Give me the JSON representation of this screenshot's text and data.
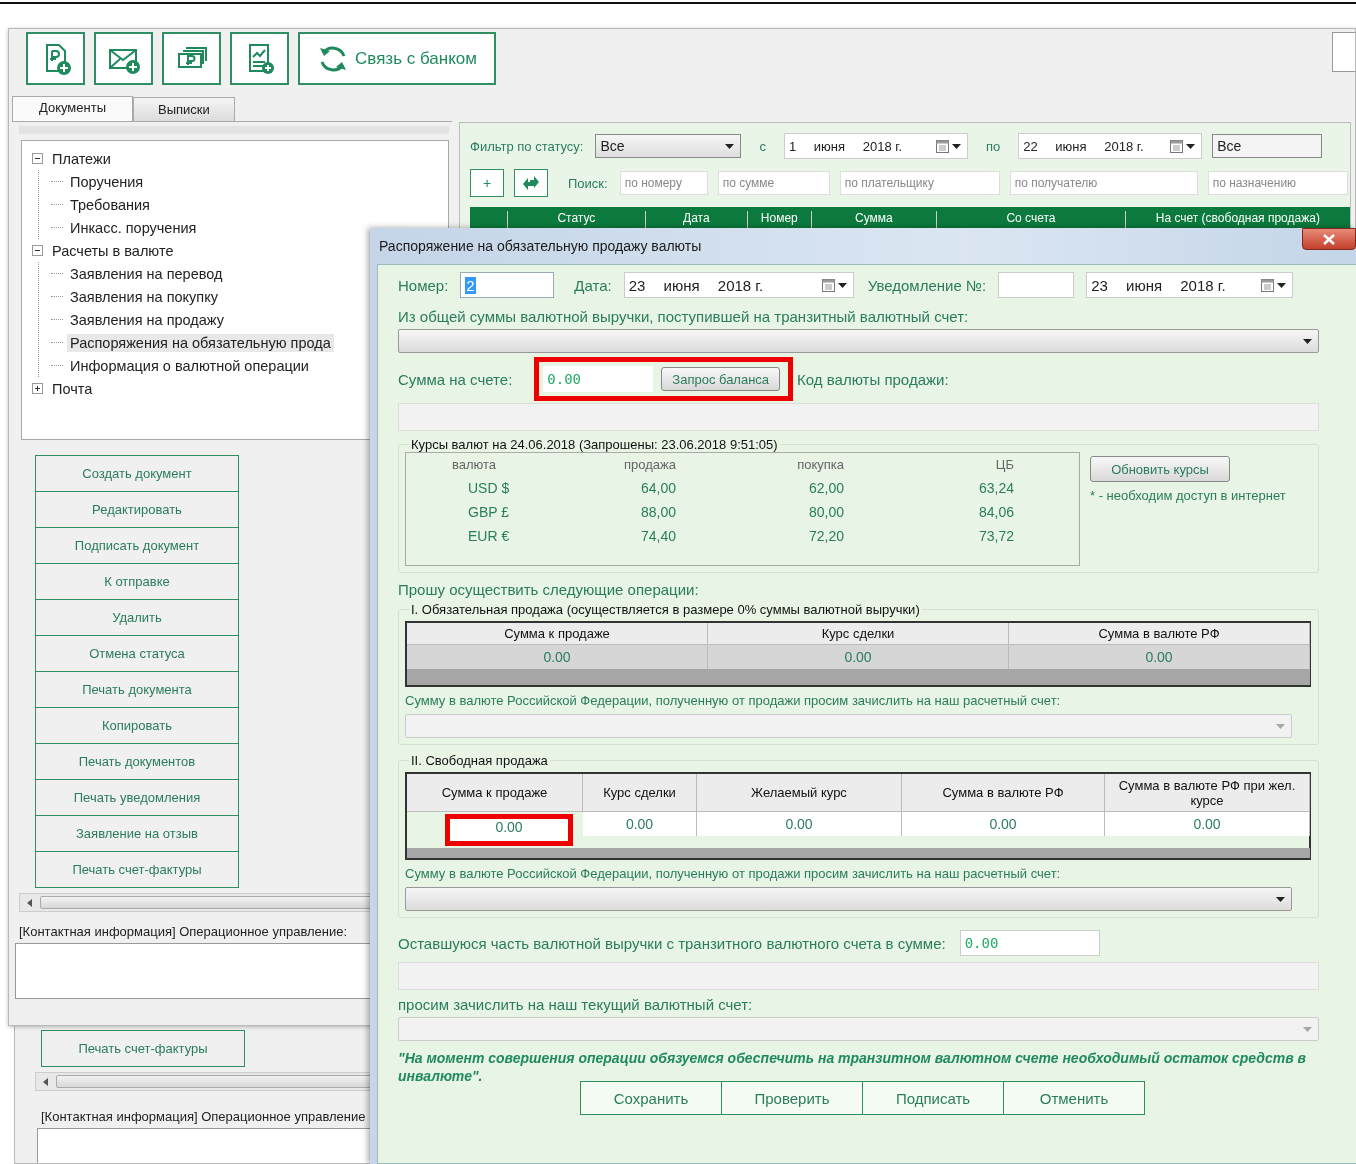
{
  "main_window": {
    "bank_button": "Связь с банком",
    "tabs": [
      {
        "label": "Документы",
        "selected": true
      },
      {
        "label": "Выписки",
        "selected": false
      }
    ],
    "tree": [
      {
        "label": "Платежи",
        "selected": false,
        "expanded": true,
        "children": [
          {
            "label": "Поручения",
            "selected": false
          },
          {
            "label": "Требования",
            "selected": false
          },
          {
            "label": "Инкасс. поручения",
            "selected": false
          }
        ]
      },
      {
        "label": "Расчеты в валюте",
        "selected": false,
        "expanded": true,
        "children": [
          {
            "label": "Заявления на перевод",
            "selected": false
          },
          {
            "label": "Заявления на покупку",
            "selected": false
          },
          {
            "label": "Заявления на продажу",
            "selected": false
          },
          {
            "label": "Распоряжения на обязательную прода",
            "selected": true
          },
          {
            "label": "Информация о валютной операции",
            "selected": false
          }
        ]
      },
      {
        "label": "Почта",
        "selected": false,
        "expanded": false
      }
    ],
    "actions": [
      "Создать документ",
      "Редактировать",
      "Подписать документ",
      "К отправке",
      "Удалить",
      "Отмена статуса",
      "Печать документа",
      "Копировать",
      "Печать документов",
      "Печать уведомления",
      "Заявление на отзыв",
      "Печать счет-фактуры"
    ],
    "contact_label": "[Контактная информация] Операционное управление:",
    "filter": {
      "label": "Фильтр по статусу:",
      "status": "Все",
      "from_label": "с",
      "from_date": {
        "day": "1",
        "month": "июня",
        "year": "2018 г."
      },
      "to_label": "по",
      "to_date": {
        "day": "22",
        "month": "июня",
        "year": "2018 г."
      },
      "status_2": "Все"
    },
    "add_button": "+",
    "search": {
      "label": "Поиск:",
      "fields": [
        {
          "placeholder": "по номеру"
        },
        {
          "placeholder": "по сумме"
        },
        {
          "placeholder": "по плательщику"
        },
        {
          "placeholder": "по получателю"
        },
        {
          "placeholder": "по назначению"
        }
      ]
    },
    "table": {
      "columns": [
        "Статус",
        "Дата",
        "Номер",
        "Сумма",
        "Со счета",
        "На счет (свободная продажа)"
      ]
    }
  },
  "back_window": {
    "actions": [
      "Печать счет-фактуры"
    ],
    "contact_label": "[Контактная информация] Операционное управление"
  },
  "dialog": {
    "title": "Распоряжение на обязательную продажу валюты",
    "number": {
      "label": "Номер:",
      "value": "2"
    },
    "date": {
      "label": "Дата:",
      "day": "23",
      "month": "июня",
      "year": "2018 г."
    },
    "notice": {
      "label": "Уведомление №:",
      "day": "23",
      "month": "июня",
      "year": "2018 г."
    },
    "source_label": "Из общей суммы валютной выручки, поступившей на транзитный валютный счет:",
    "balance": {
      "label": "Сумма на счете:",
      "value": "0.00",
      "button": "Запрос баланса",
      "highlighted": true
    },
    "currency_code_label": "Код валюты продажи:",
    "rates": {
      "title": "Курсы валют на 24.06.2018 (Запрошены: 23.06.2018 9:51:05)",
      "columns": [
        "валюта",
        "продажа",
        "покупка",
        "ЦБ"
      ],
      "rows": [
        [
          "USD $",
          "64,00",
          "62,00",
          "63,24"
        ],
        [
          "GBP £",
          "88,00",
          "80,00",
          "84,06"
        ],
        [
          "EUR €",
          "74,40",
          "72,20",
          "73,72"
        ]
      ],
      "refresh_button": "Обновить курсы",
      "note": "* - необходим доступ в интернет"
    },
    "request_label": "Прошу осуществить следующие операции:",
    "mandatory": {
      "title": "I. Обязательная продажа (осуществляется в размере 0% суммы валютной выручки)",
      "disabled": true,
      "columns": [
        "Сумма к продаже",
        "Курс сделки",
        "Сумма в валюте РФ"
      ],
      "cells": [
        {
          "value": "0.00",
          "highlighted": false
        },
        {
          "value": "0.00",
          "highlighted": false
        },
        {
          "value": "0.00",
          "highlighted": false
        }
      ],
      "account_label": "Сумму в валюте Российской Федерации, полученную от продажи просим зачислить на наш расчетный счет:"
    },
    "free": {
      "title": "II. Свободная продажа",
      "disabled": false,
      "columns": [
        "Сумма к продаже",
        "Курс сделки",
        "Желаемый курс",
        "Сумма в валюте РФ",
        "Сумма в валюте РФ при жел. курсе"
      ],
      "cells": [
        {
          "value": "0.00",
          "highlighted": true
        },
        {
          "value": "0.00",
          "highlighted": false
        },
        {
          "value": "0.00",
          "highlighted": false
        },
        {
          "value": "0.00",
          "highlighted": false
        },
        {
          "value": "0.00",
          "highlighted": false
        }
      ],
      "account_label": "Сумму в валюте Российской Федерации, полученную от продажи просим зачислить на наш расчетный счет:"
    },
    "remainder": {
      "label": "Оставшуюся часть валютной выручки с транзитного валютного счета в сумме:",
      "value": "0.00"
    },
    "current_account_label": "просим зачислить на наш текущий валютный счет:",
    "pledge": "\"На момент совершения операции обязуемся обеспечить на транзитном валютном счете необходимый остаток средств в инвалюте\".",
    "buttons": [
      "Сохранить",
      "Проверить",
      "Подписать",
      "Отменить"
    ]
  }
}
